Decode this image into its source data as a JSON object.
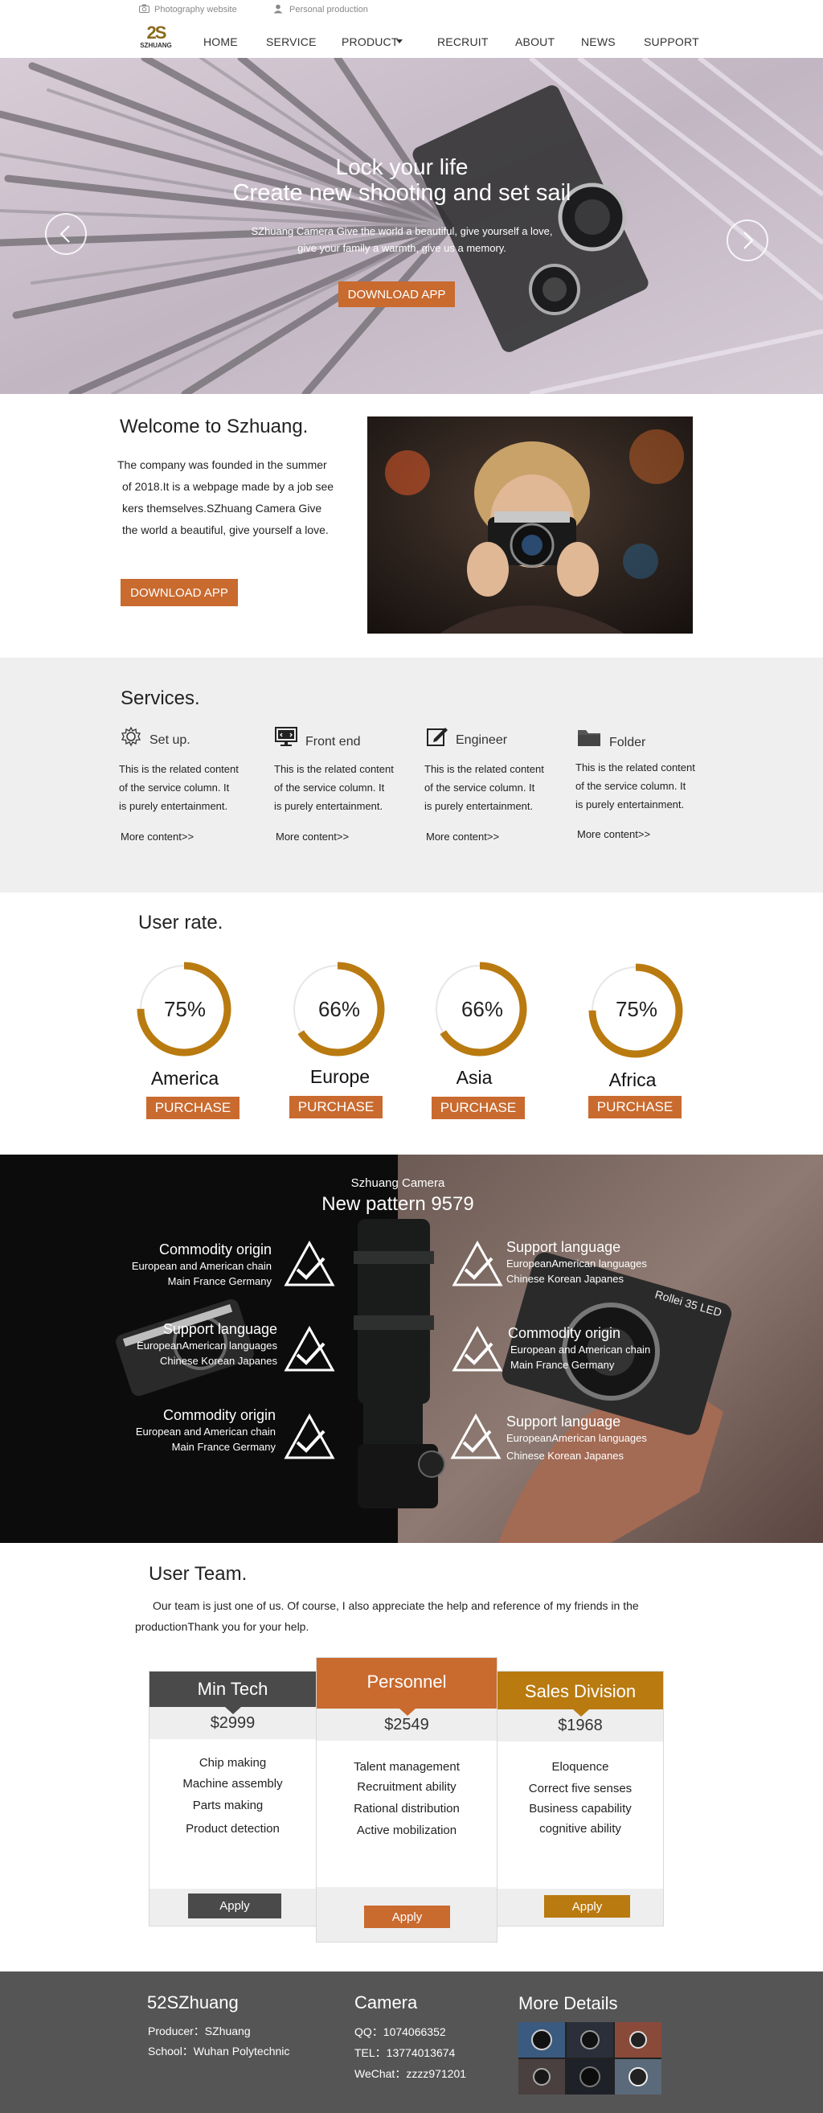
{
  "topbar": {
    "left_text": "Photography website",
    "right_text": "Personal production"
  },
  "brand": {
    "logo_mark": "2S",
    "logo_text": "SZHUANG",
    "accent": "#c96a2f",
    "gold": "#b97a10"
  },
  "nav": {
    "items": [
      "HOME",
      "SERVICE",
      "PRODUCT",
      "RECRUIT",
      "ABOUT",
      "NEWS",
      "SUPPORT"
    ]
  },
  "hero": {
    "title_line1": "Lock your life",
    "title_line2": "Create new shooting and set sail",
    "desc_line1": "SZhuang Camera Give the world a beautiful, give yourself a love,",
    "desc_line2": "give your family a warmth, give us a memory.",
    "button": "DOWNLOAD APP"
  },
  "welcome": {
    "title": "Welcome to Szhuang.",
    "para_lines": [
      "The company was founded in the summer",
      "of 2018.It is a webpage made by a job see",
      "kers themselves.SZhuang Camera Give",
      "the world a beautiful, give yourself a love."
    ],
    "button": "DOWNLOAD APP"
  },
  "services": {
    "title": "Services.",
    "items": [
      {
        "icon": "gear-icon",
        "title": "Set up.",
        "lines": [
          "This is the related content",
          "of the service column. It",
          "is purely entertainment."
        ],
        "more": "More content>>"
      },
      {
        "icon": "monitor-icon",
        "title": "Front end",
        "lines": [
          "This is the related content",
          "of the service column. It",
          "is purely entertainment."
        ],
        "more": "More content>>"
      },
      {
        "icon": "edit-icon",
        "title": "Engineer",
        "lines": [
          "This is the related content",
          "of the service column. It",
          "is purely entertainment."
        ],
        "more": "More content>>"
      },
      {
        "icon": "folder-icon",
        "title": "Folder",
        "lines": [
          "This is the related content",
          "of the service column. It",
          "is purely entertainment."
        ],
        "more": "More content>>"
      }
    ]
  },
  "user_rate": {
    "title": "User rate.",
    "items": [
      {
        "pct_label": "75%",
        "value": 0.75,
        "region": "America",
        "button": "PURCHASE"
      },
      {
        "pct_label": "66%",
        "value": 0.66,
        "region": "Europe",
        "button": "PURCHASE"
      },
      {
        "pct_label": "66%",
        "value": 0.66,
        "region": "Asia",
        "button": "PURCHASE"
      },
      {
        "pct_label": "75%",
        "value": 0.75,
        "region": "Africa",
        "button": "PURCHASE"
      }
    ]
  },
  "pattern": {
    "subtitle": "Szhuang Camera",
    "title": "New pattern 9579",
    "left": [
      {
        "title": "Commodity origin",
        "lines": [
          "European and American chain",
          "Main France Germany"
        ]
      },
      {
        "title": "Support language",
        "lines": [
          "EuropeanAmerican languages",
          "Chinese Korean Japanes"
        ]
      },
      {
        "title": "Commodity origin",
        "lines": [
          "European and American chain",
          "Main France Germany"
        ]
      }
    ],
    "right": [
      {
        "title": "Support language",
        "lines": [
          "EuropeanAmerican languages",
          "Chinese Korean Japanes"
        ]
      },
      {
        "title": "Commodity origin",
        "lines": [
          "European and American chain",
          "Main France Germany"
        ]
      },
      {
        "title": "Support language",
        "lines": [
          "EuropeanAmerican languages",
          "Chinese Korean Japanes"
        ]
      }
    ],
    "camera_label": "Rollei 35 LED"
  },
  "team": {
    "title": "User Team.",
    "intro_line1": "Our team is just one of us. Of course, I also appreciate the help and reference of my friends in the",
    "intro_line2": "productionThank you for your help.",
    "cards": [
      {
        "name": "Min Tech",
        "price": "$2999",
        "color": "#4a4a4a",
        "items": [
          "Chip making",
          "Machine assembly",
          "Parts making",
          "Product detection"
        ],
        "button": "Apply"
      },
      {
        "name": "Personnel",
        "price": "$2549",
        "color": "#c96a2f",
        "items": [
          "Talent management",
          "Recruitment ability",
          "Rational distribution",
          "Active mobilization"
        ],
        "button": "Apply"
      },
      {
        "name": "Sales Division",
        "price": "$1968",
        "color": "#b97a10",
        "items": [
          "Eloquence",
          "Correct five senses",
          "Business capability",
          "cognitive ability"
        ],
        "button": "Apply"
      }
    ]
  },
  "footer": {
    "col1_title": "52SZhuang",
    "col1_lines": [
      "Producer：SZhuang",
      "School：Wuhan Polytechnic"
    ],
    "col2_title": "Camera",
    "col2_lines": [
      "QQ：1074066352",
      "TEL：13774013674",
      "WeChat：zzzz971201"
    ],
    "col3_title": "More Details"
  }
}
